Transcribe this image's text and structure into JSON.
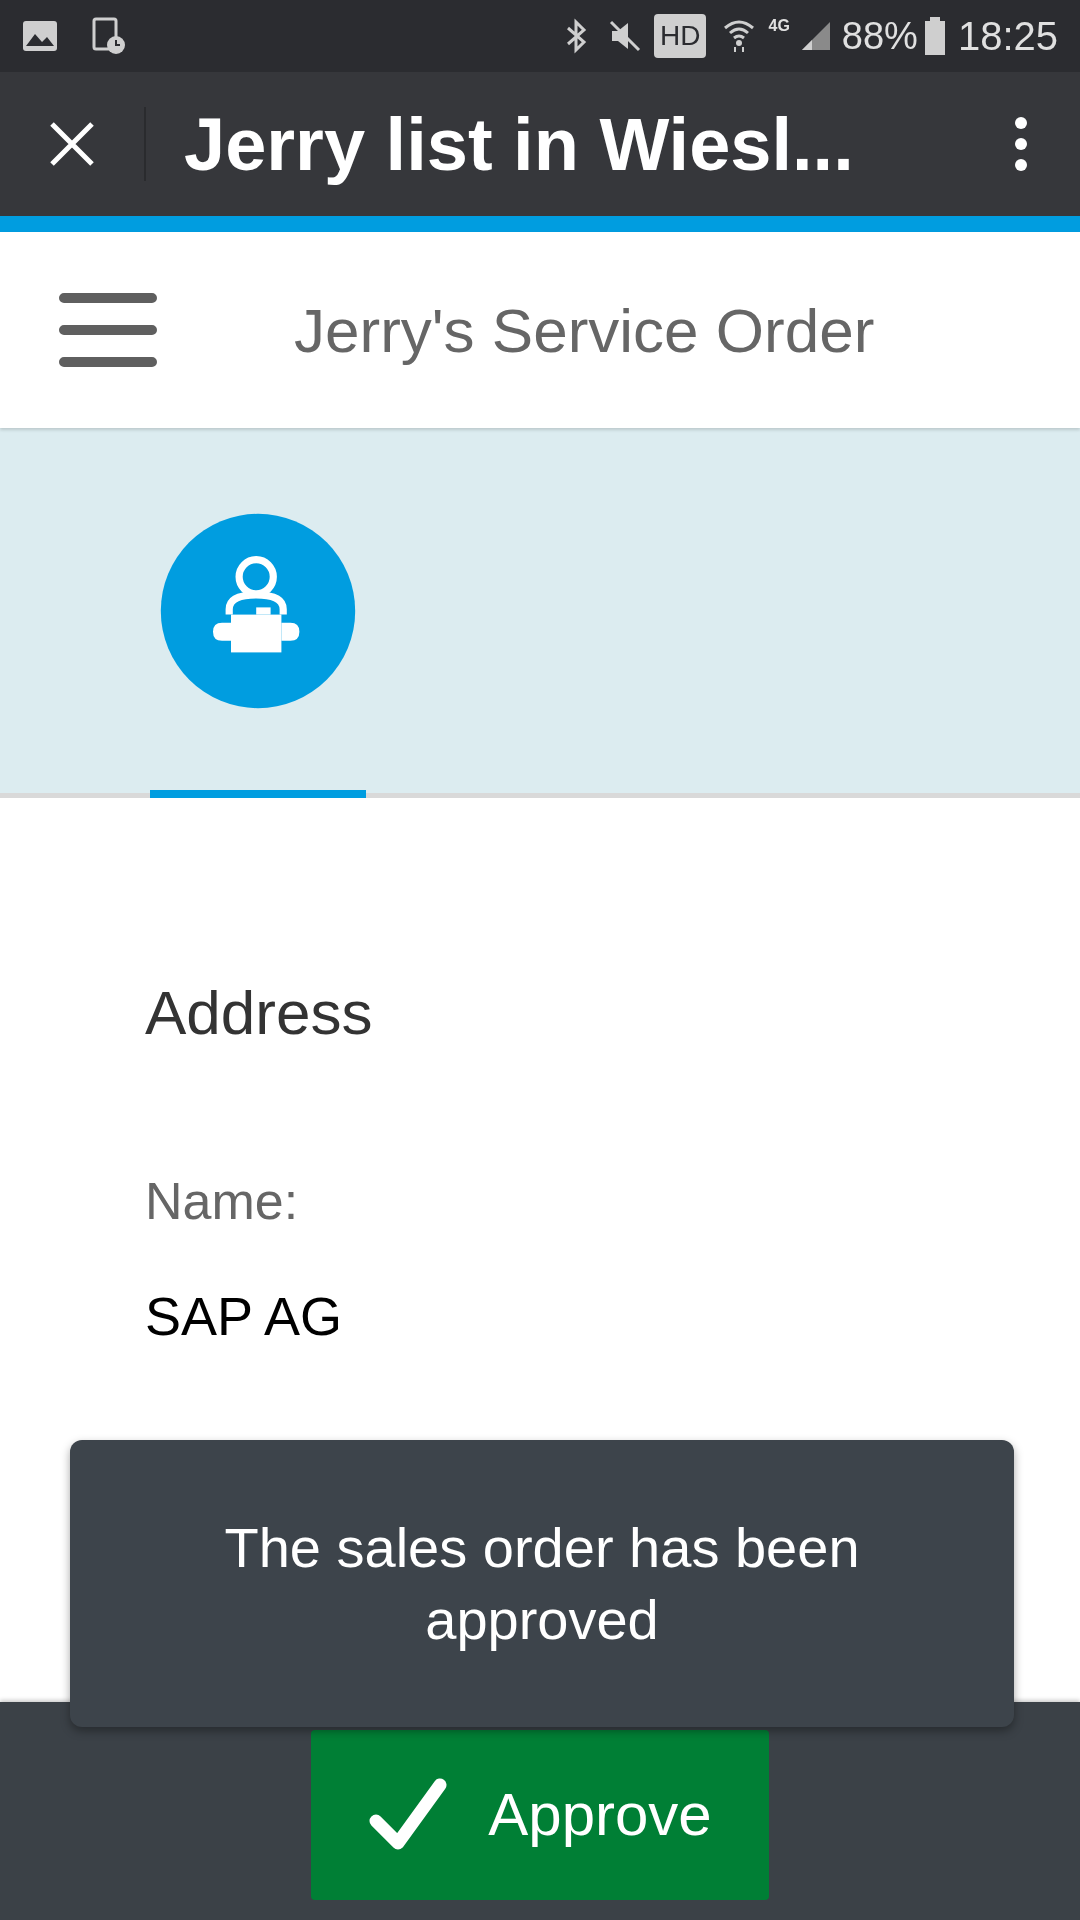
{
  "status_bar": {
    "hd": "HD",
    "network": "4G",
    "battery": "88%",
    "time": "18:25"
  },
  "app_bar": {
    "title": "Jerry list in Wiesl..."
  },
  "header": {
    "title": "Jerry's Service Order"
  },
  "tabs": [
    {
      "selected": true
    }
  ],
  "section": {
    "title": "Address",
    "fields": [
      {
        "label": "Name:",
        "value": "SAP AG"
      }
    ]
  },
  "toast": {
    "message": "The sales order has been approved"
  },
  "footer": {
    "button": "Approve"
  }
}
